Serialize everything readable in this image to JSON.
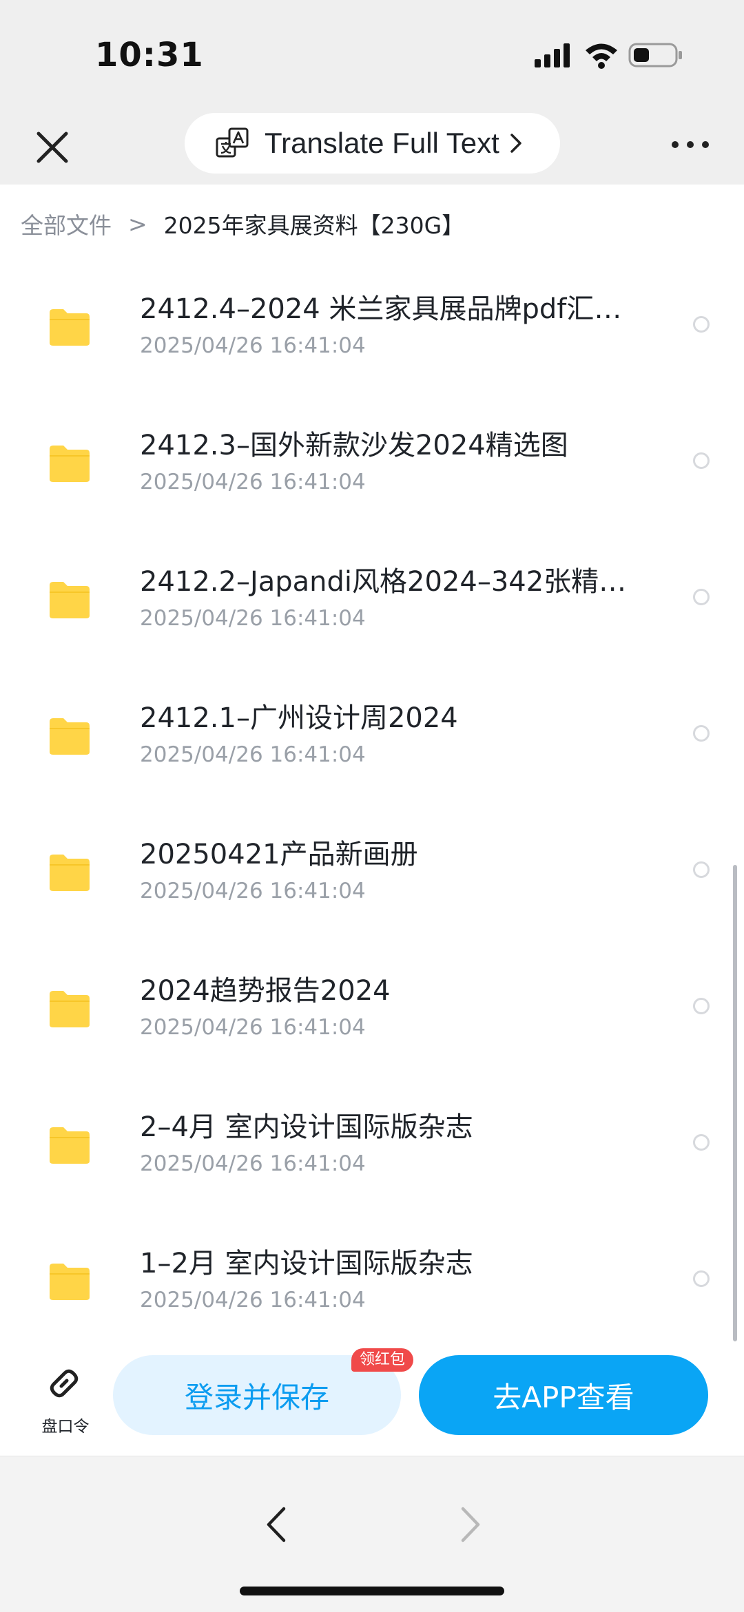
{
  "status_bar": {
    "time": "10:31",
    "icons": [
      "signal-icon",
      "wifi-icon",
      "battery-icon"
    ]
  },
  "nav": {
    "translate_label": "Translate Full Text",
    "icons": [
      "close-icon",
      "translate-icon",
      "chevron-right-icon",
      "more-icon"
    ]
  },
  "breadcrumb": {
    "root": "全部文件",
    "separator": ">",
    "current": "2025年家具展资料【230G】"
  },
  "files": [
    {
      "name": "2412.4–2024 米兰家具展品牌pdf汇…",
      "date": "2025/04/26 16:41:04"
    },
    {
      "name": "2412.3–国外新款沙发2024精选图",
      "date": "2025/04/26 16:41:04"
    },
    {
      "name": "2412.2–Japandi风格2024–342张精…",
      "date": "2025/04/26 16:41:04"
    },
    {
      "name": "2412.1–广州设计周2024",
      "date": "2025/04/26 16:41:04"
    },
    {
      "name": "20250421产品新画册",
      "date": "2025/04/26 16:41:04"
    },
    {
      "name": "2024趋势报告2024",
      "date": "2025/04/26 16:41:04"
    },
    {
      "name": "2–4月 室内设计国际版杂志",
      "date": "2025/04/26 16:41:04"
    },
    {
      "name": "1–2月 室内设计国际版杂志",
      "date": "2025/04/26 16:41:04"
    }
  ],
  "actions": {
    "link_label": "盘口令",
    "save_label": "登录并保存",
    "badge": "领红包",
    "app_label": "去APP查看"
  },
  "colors": {
    "folder": "#ffd547",
    "accent": "#0aa5f5",
    "accent_light": "#e3f3ff",
    "badge": "#f04a4a"
  }
}
